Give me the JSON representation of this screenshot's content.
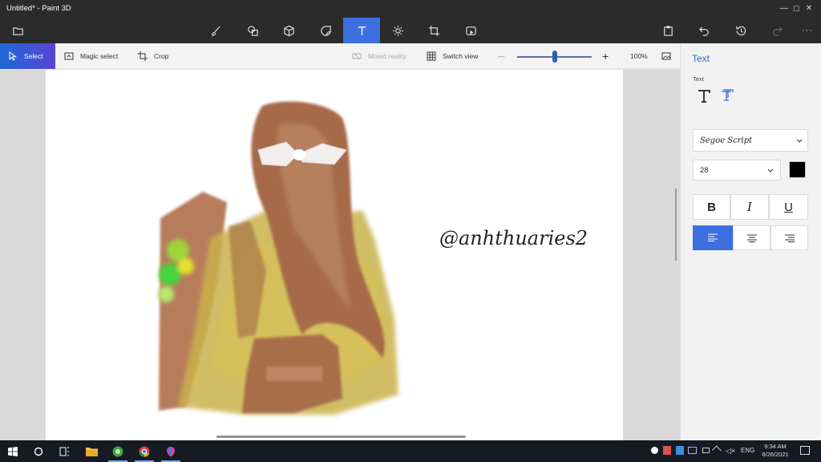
{
  "window": {
    "title": "Untitled* - Paint 3D",
    "min_glyph": "—",
    "max_glyph": "☐",
    "close_glyph": "✕"
  },
  "toolbar": {
    "active_tool": "text",
    "more_glyph": "···"
  },
  "command_bar": {
    "select_label": "Select",
    "magic_select_label": "Magic select",
    "crop_label": "Crop",
    "mixed_reality_label": "Mixed reality",
    "switch_view_label": "Switch view",
    "zoom_minus": "—",
    "zoom_plus": "+",
    "zoom_value": "100%",
    "zoom_level": 0.5
  },
  "canvas": {
    "watermark_text": "@anhthuaries2"
  },
  "panel": {
    "title": "Text",
    "section_label": "Text",
    "font_family": "Segoe Script",
    "font_size": "28",
    "text_color": "#000000",
    "bold_glyph": "B",
    "italic_glyph": "I",
    "underline_glyph": "U",
    "align_active": "left"
  },
  "taskbar": {
    "lang": "ENG",
    "time": "9:34 AM",
    "date": "6/26/2021"
  },
  "colors": {
    "accent": "#3c6fe0",
    "titlebar": "#2b2b2b",
    "panel_title": "#2a6bd1"
  }
}
